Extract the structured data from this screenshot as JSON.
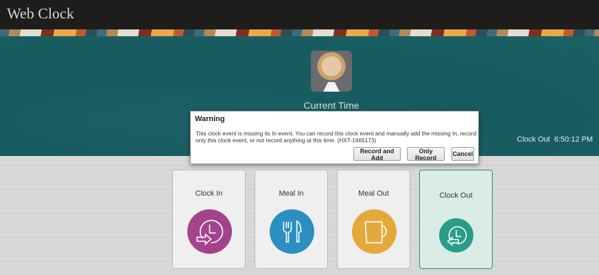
{
  "app": {
    "title": "Web Clock"
  },
  "hero": {
    "current_time_label": "Current Time",
    "status_label": "Clock Out",
    "status_time": "6:50:12 PM"
  },
  "cards": [
    {
      "label": "Clock In",
      "icon": "clock-in-icon",
      "color": "#a3438b"
    },
    {
      "label": "Meal In",
      "icon": "fork-knife-icon",
      "color": "#2b8fc1"
    },
    {
      "label": "Meal Out",
      "icon": "mug-icon",
      "color": "#e3aa3b"
    },
    {
      "label": "Clock Out",
      "icon": "clock-out-icon",
      "color": "#2a9c88",
      "selected": true
    }
  ],
  "dialog": {
    "title": "Warning",
    "message": "This clock event is missing its In event. You can record this clock event and manually add the missing In, record only this clock event, or not record anything at this time. (HXT-1665173)",
    "buttons": {
      "record_and_add": "Record and Add",
      "only_record": "Only Record",
      "cancel": "Cancel"
    }
  }
}
